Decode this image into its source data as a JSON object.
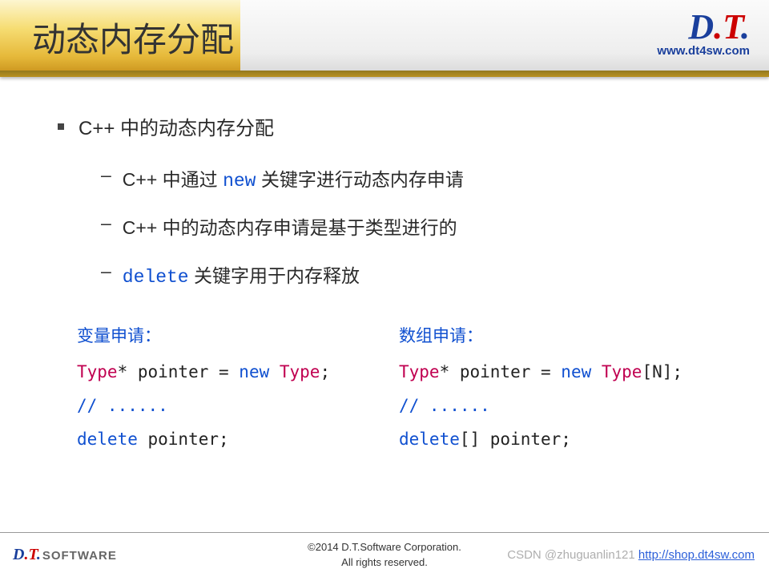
{
  "header": {
    "title": "动态内存分配",
    "logo_d": "D",
    "logo_t": "T",
    "dot": ".",
    "url": "www.dt4sw.com"
  },
  "main": {
    "heading": "C++ 中的动态内存分配",
    "sub1_a": "C++ 中通过 ",
    "sub1_kw": "new",
    "sub1_b": " 关键字进行动态内存申请",
    "sub2": "C++ 中的动态内存申请是基于类型进行的",
    "sub3_kw": "delete",
    "sub3_b": " 关键字用于内存释放"
  },
  "examples": {
    "left_label": "变量申请：",
    "right_label": "数组申请：",
    "l1_type": "Type",
    "l1_star_ptr": "* pointer = ",
    "l1_new": "new",
    "l1_type2": " Type",
    "l1_end": ";",
    "l2": "// ......",
    "l3_del": "delete",
    "l3_rest": " pointer;",
    "r1_type": "Type",
    "r1_star_ptr": "* pointer = ",
    "r1_new": "new",
    "r1_type2": " Type",
    "r1_arr": "[N];",
    "r2": "// ......",
    "r3_del": "delete",
    "r3_rest": "[] pointer;"
  },
  "footer": {
    "logo_d": "D",
    "logo_t": "T",
    "dot": ".",
    "software": "SOFTWARE",
    "copyright": "©2014 D.T.Software Corporation.",
    "rights": "All rights reserved.",
    "watermark": "CSDN @zhuguanlin121",
    "shop": "http://shop.dt4sw.com"
  }
}
